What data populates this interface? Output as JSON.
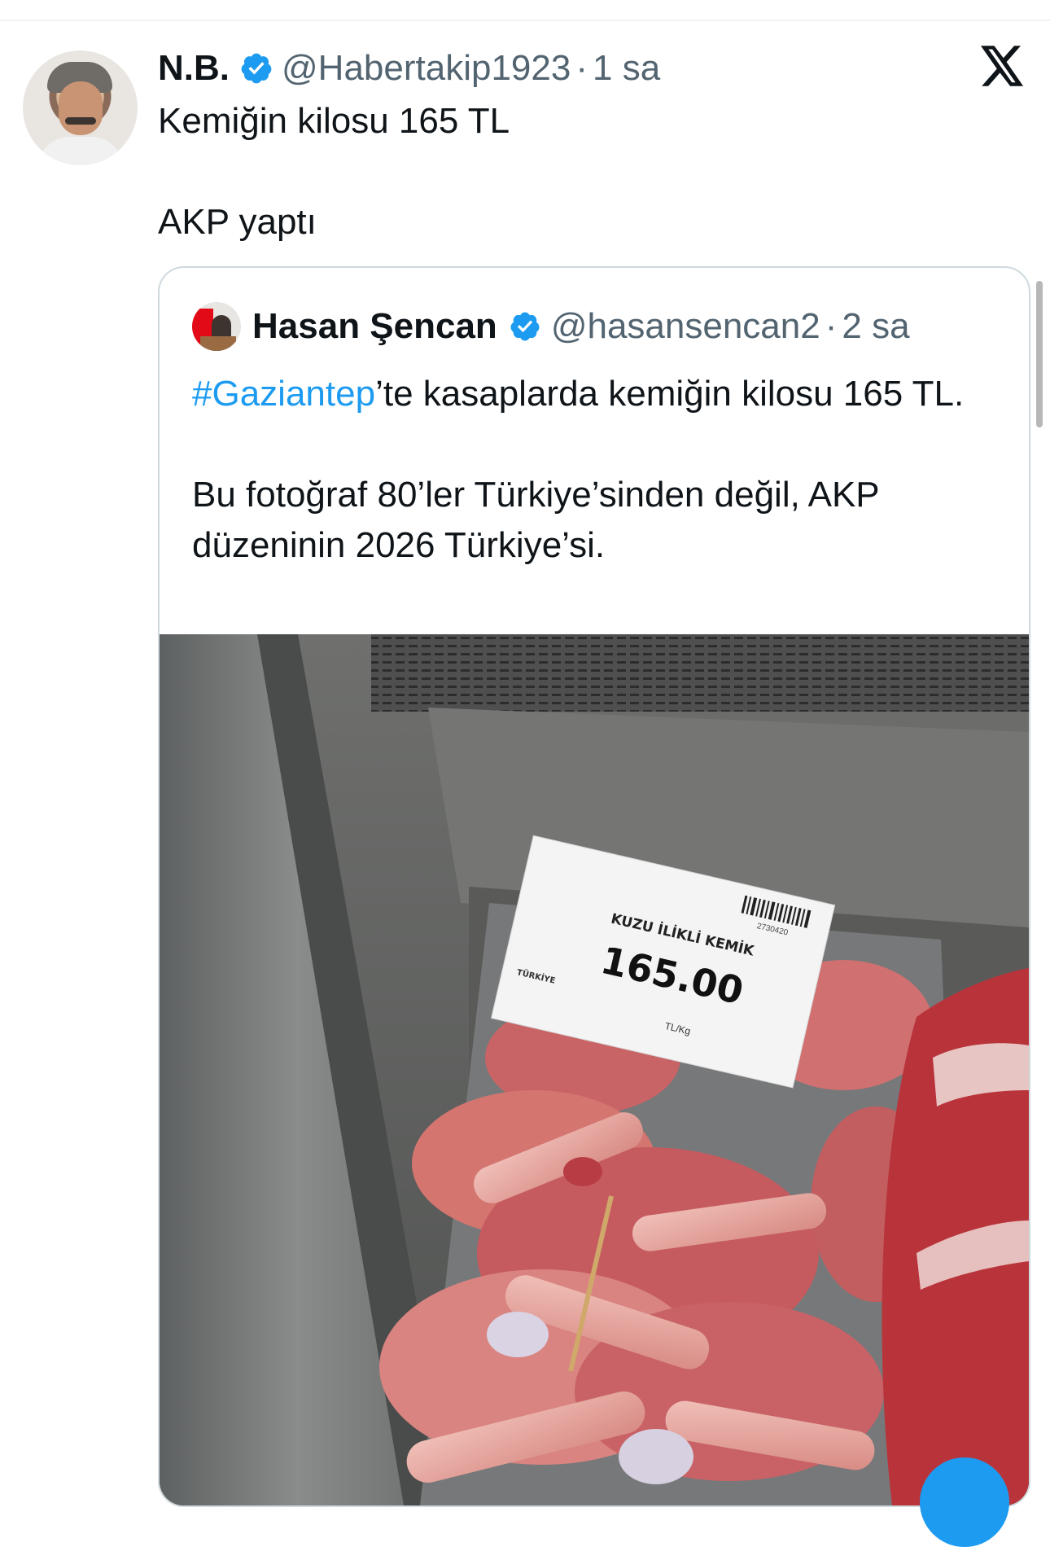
{
  "tweet": {
    "author": {
      "name": "N.B.",
      "handle": "@Habertakip1923",
      "separator": "·",
      "time": "1 sa"
    },
    "text_line1": "Kemiğin kilosu 165 TL",
    "text_line2": "AKP yaptı"
  },
  "quoted_tweet": {
    "author": {
      "name": "Hasan Şencan",
      "handle": "@hasansencan2",
      "separator": "·",
      "time": "2 sa"
    },
    "hashtag": "#Gaziantep",
    "text_part1": "’te kasaplarda kemiğin kilosu 165 TL.",
    "text_para2": "Bu fotoğraf 80’ler Türkiye’sinden değil, AKP düzeninin 2026 Türkiye’si."
  },
  "photo_label": {
    "product_name": "KUZU İLİKLİ KEMİK",
    "price": "165.00",
    "unit": "TL/Kg",
    "brand": "TÜRKİYE",
    "code": "2730420"
  },
  "icons": {
    "brand": "x-logo-icon",
    "verified": "verified-badge-icon"
  },
  "colors": {
    "accent": "#1d9bf0",
    "secondary_text": "#536471",
    "border": "#cfd9de"
  }
}
